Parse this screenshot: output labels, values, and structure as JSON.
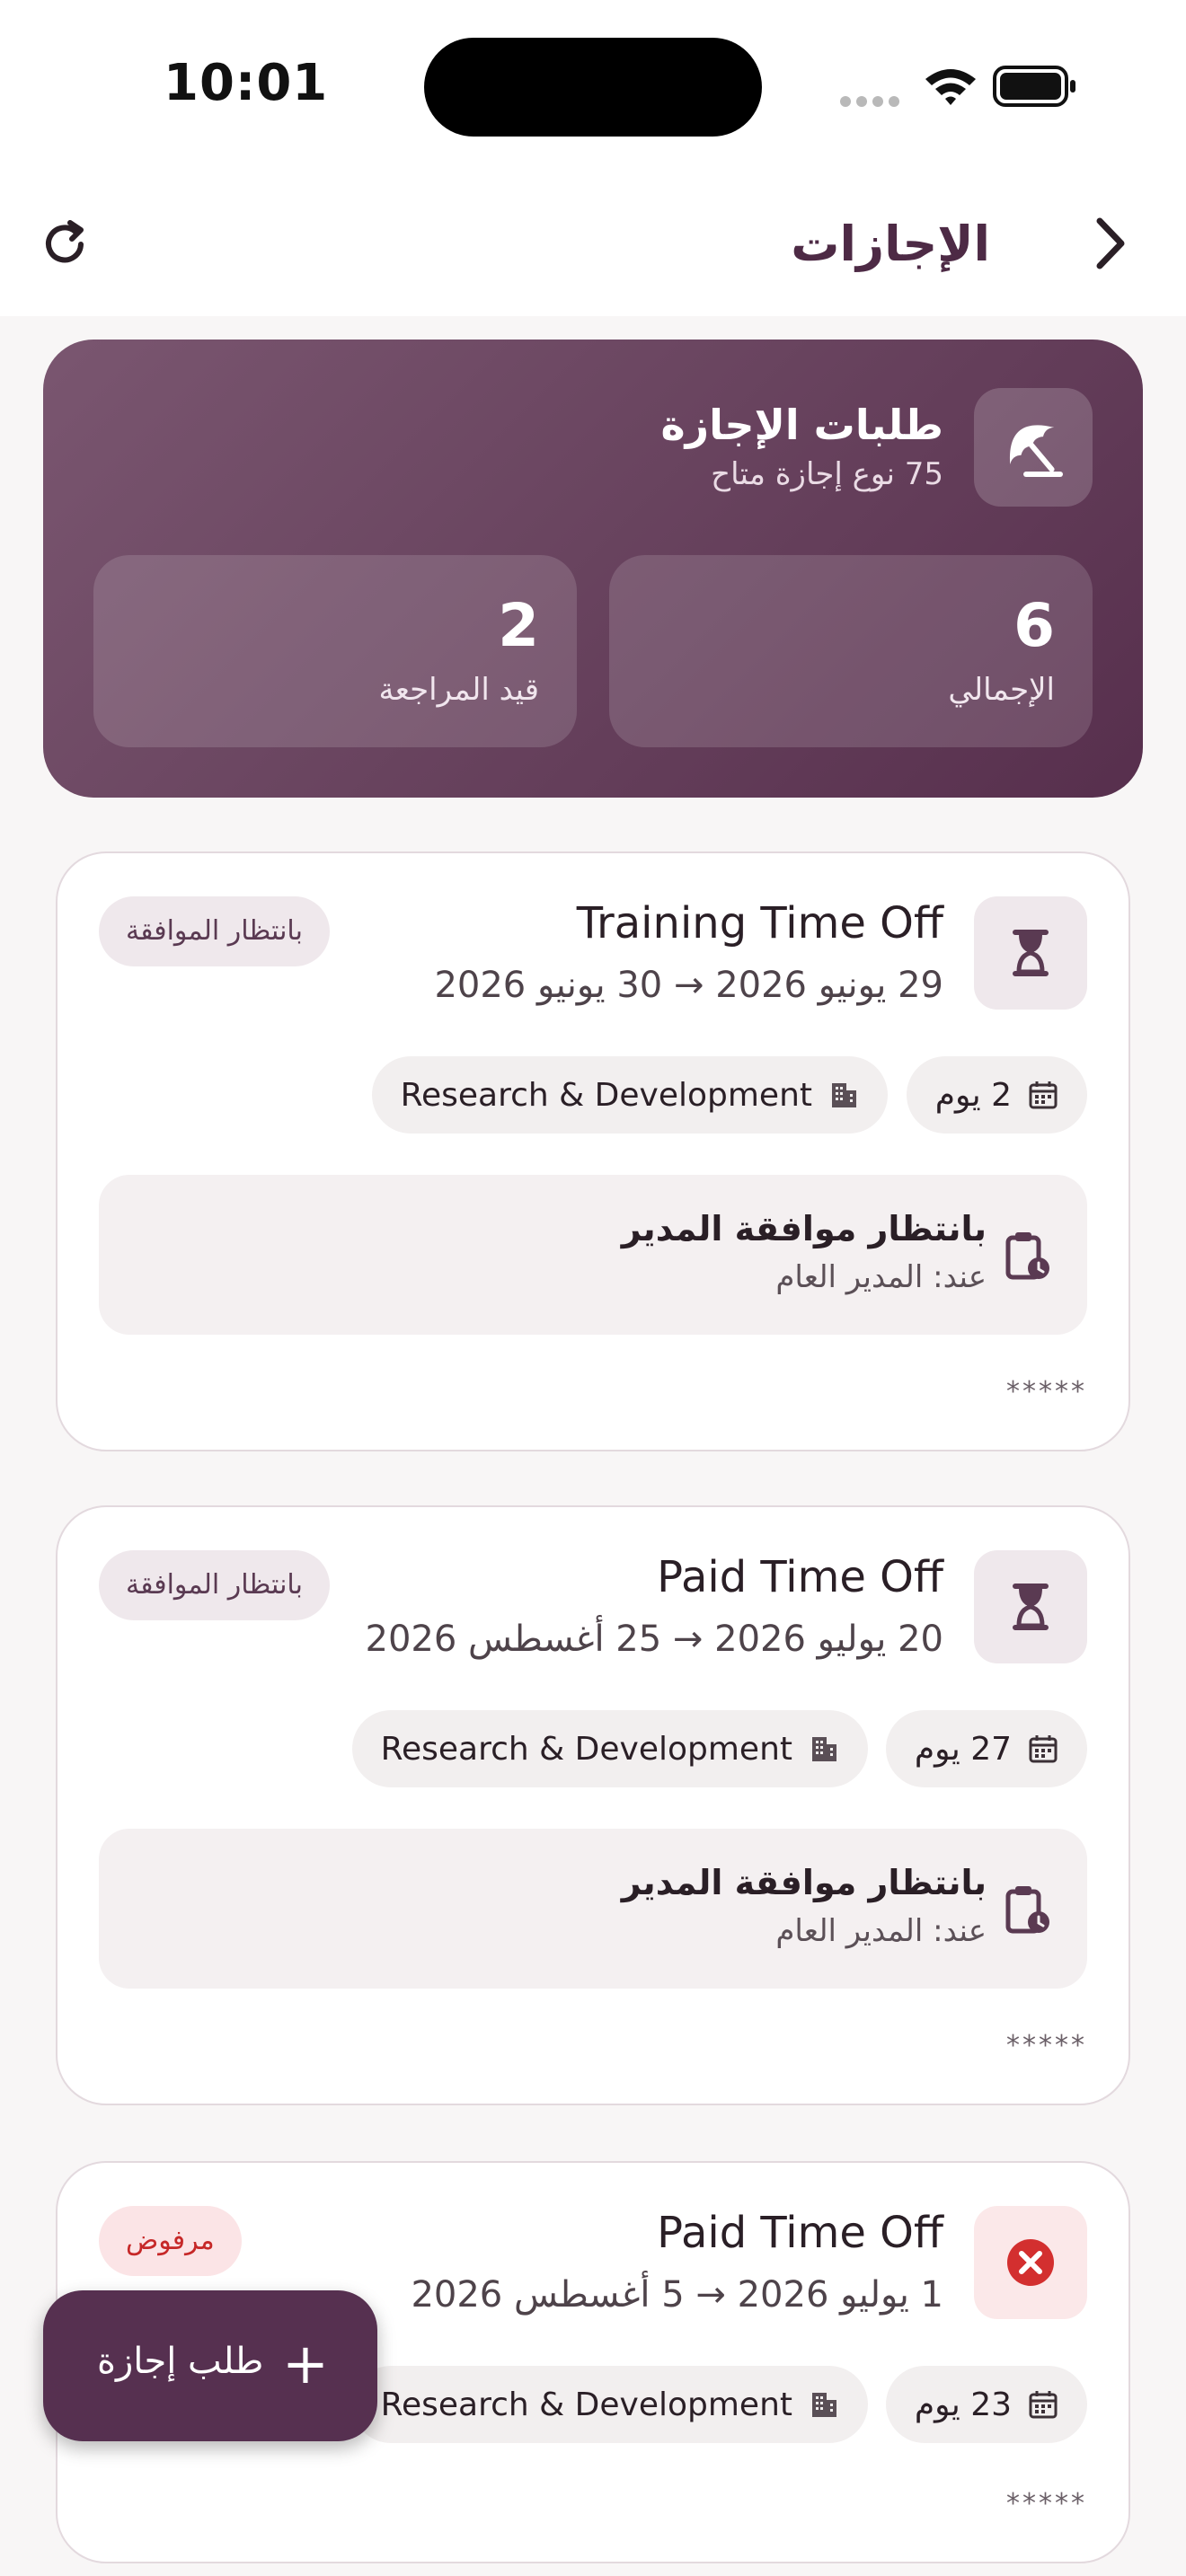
{
  "status_bar": {
    "time": "10:01"
  },
  "app_bar": {
    "title": "الإجازات"
  },
  "summary": {
    "title": "طلبات الإجازة",
    "subtitle": "75 نوع إجازة متاح",
    "stats": [
      {
        "value": "6",
        "label": "الإجمالي"
      },
      {
        "value": "2",
        "label": "قيد المراجعة"
      }
    ]
  },
  "requests": [
    {
      "type": "Training Time Off",
      "dates": "29 يونيو 2026 → 30 يونيو 2026",
      "status": "بانتظار الموافقة",
      "days": "2 يوم",
      "department": "Research & Development",
      "approval_title": "بانتظار موافقة المدير",
      "approval_sub": "عند: المدير العام",
      "masked": "*****"
    },
    {
      "type": "Paid Time Off",
      "dates": "20 يوليو 2026 → 25 أغسطس 2026",
      "status": "بانتظار الموافقة",
      "days": "27 يوم",
      "department": "Research & Development",
      "approval_title": "بانتظار موافقة المدير",
      "approval_sub": "عند: المدير العام",
      "masked": "*****"
    },
    {
      "type": "Paid Time Off",
      "dates": "1 يوليو 2026 → 5 أغسطس 2026",
      "status": "مرفوض",
      "days": "23 يوم",
      "department": "Research & Development",
      "masked": "*****"
    }
  ],
  "fab": {
    "label": "طلب إجازة"
  },
  "icons": {
    "back": "chevron-right-icon",
    "refresh": "refresh-icon",
    "summary": "umbrella-icon",
    "pending": "hourglass-icon",
    "rejected": "close-circle-icon",
    "days": "calendar-icon",
    "department": "building-icon",
    "approval": "clipboard-clock-icon",
    "fab": "plus-icon"
  },
  "colors": {
    "primary": "#563050",
    "hero_gradient_start": "#7a5670",
    "hero_gradient_end": "#572f4d",
    "rejected": "#c62828",
    "background": "#f8f6f6"
  }
}
